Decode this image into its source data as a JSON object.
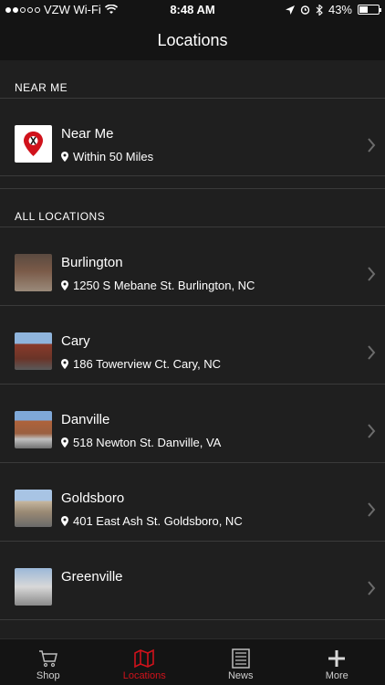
{
  "status_bar": {
    "carrier": "VZW Wi-Fi",
    "time": "8:48 AM",
    "battery": "43%",
    "battery_fraction": 0.43,
    "signal_bars_on": 2,
    "signal_bars_total": 5
  },
  "nav": {
    "title": "Locations"
  },
  "sections": [
    {
      "header": "NEAR ME",
      "rows": [
        {
          "title": "Near Me",
          "subtitle": "Within 50 Miles",
          "icon": "map-pin-logo-icon"
        }
      ]
    },
    {
      "header": "ALL LOCATIONS",
      "rows": [
        {
          "title": "Burlington",
          "subtitle": "1250 S Mebane St. Burlington, NC",
          "icon": "store-photo"
        },
        {
          "title": "Cary",
          "subtitle": "186 Towerview Ct. Cary, NC",
          "icon": "store-photo"
        },
        {
          "title": "Danville",
          "subtitle": "518 Newton St. Danville, VA",
          "icon": "store-photo"
        },
        {
          "title": "Goldsboro",
          "subtitle": "401 East Ash St. Goldsboro, NC",
          "icon": "store-photo"
        },
        {
          "title": "Greenville",
          "subtitle": "",
          "icon": "store-photo"
        }
      ]
    }
  ],
  "tabs": [
    {
      "label": "Shop",
      "icon": "cart-icon",
      "active": false
    },
    {
      "label": "Locations",
      "icon": "map-icon",
      "active": true
    },
    {
      "label": "News",
      "icon": "newspaper-icon",
      "active": false
    },
    {
      "label": "More",
      "icon": "plus-icon",
      "active": false
    }
  ],
  "colors": {
    "background": "#1f1f1f",
    "bar": "#141414",
    "accent": "#d0121b",
    "separator": "#3a3a3a"
  }
}
